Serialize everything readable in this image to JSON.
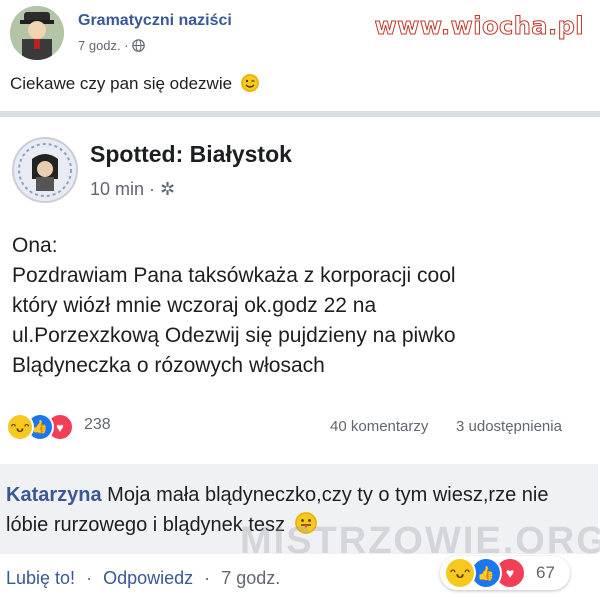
{
  "post": {
    "author": "Gramatyczni naziści",
    "time": "7 godz.",
    "text": "Ciekawe czy pan się odezwie"
  },
  "watermark": "www.wiocha.pl",
  "shared_post": {
    "author": "Spotted: Białystok",
    "time": "10 min",
    "body_lines": [
      "Ona:",
      "Pozdrawiam  Pana taksówkaża z korporacji cool",
      "który wiózł mnie wczoraj ok.godz 22 na",
      "ul.Porzexzkową Odezwij się pujdzieny na piwko",
      "Blądyneczka o rózowych włosach"
    ],
    "reaction_count": "238",
    "comments_count": "40 komentarzy",
    "shares_count": "3 udostępnienia"
  },
  "comment": {
    "author": "Katarzyna",
    "text": "Moja mała blądyneczko,czy ty o tym wiesz,rze nie lóbie rurzowego i blądynek tesz",
    "like_label": "Lubię to!",
    "reply_label": "Odpowiedz",
    "time": "7 godz.",
    "reaction_count": "67"
  },
  "watermark2": "MISTRZOWIE.ORG",
  "colors": {
    "link_blue": "#385898",
    "like_blue": "#1877f2",
    "love_red": "#f33e58",
    "haha_yellow": "#f7c81e",
    "divider": "#dadde1"
  }
}
